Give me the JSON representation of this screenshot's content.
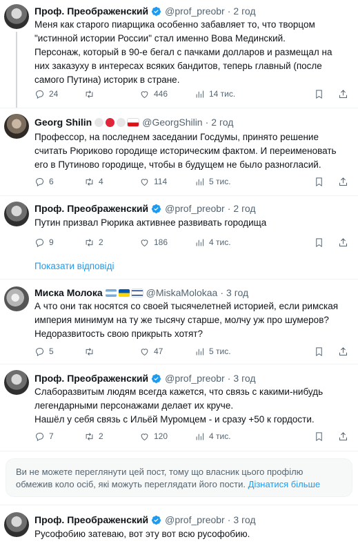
{
  "tweets": [
    {
      "name": "Проф. Преображенский",
      "handle": "@prof_preobr",
      "time": "2 год",
      "text": "Меня как старого пиарщика особенно забавляет то, что творцом \"истинной истории России\" стал именно Вова Мединский.\nПерсонаж, который в 90-е бегал с пачками долларов и размещал на них заказуху в интересах всяких бандитов, теперь главный (после самого Путина) историк в стране.",
      "replies": "24",
      "retweets": "",
      "likes": "446",
      "views": "14 тис."
    },
    {
      "name": "Georg Shilin",
      "handle": "@GeorgShilin",
      "time": "2 год",
      "text": "Профессор, на последнем заседании Госдумы, принято решение считать Рюриково городище историческим фактом. И переименовать его в Путиново городище, чтобы в будущем не было разногласий.",
      "replies": "6",
      "retweets": "4",
      "likes": "114",
      "views": "5 тис."
    },
    {
      "name": "Проф. Преображенский",
      "handle": "@prof_preobr",
      "time": "2 год",
      "text": "Путин призвал Рюрика активнее развивать городища",
      "replies": "9",
      "retweets": "2",
      "likes": "186",
      "views": "4 тис."
    },
    {
      "name": "Миска Молока",
      "handle": "@MiskaMolokaa",
      "time": "3 год",
      "text": "А что они так носятся со своей тысячелетней историей, если римская империя минимум на ту же тысячу старше, молчу уж про шумеров? Недоразвитость свою прикрыть хотят?",
      "replies": "5",
      "retweets": "",
      "likes": "47",
      "views": "5 тис."
    },
    {
      "name": "Проф. Преображенский",
      "handle": "@prof_preobr",
      "time": "3 год",
      "text": "Слаборазвитым людям всегда кажется, что связь с какими-нибудь легендарными персонажами делает их круче.\nНашёл у себя связь с Ильёй Муромцем - и сразу +50 к гордости.",
      "replies": "7",
      "retweets": "2",
      "likes": "120",
      "views": "4 тис."
    },
    {
      "name": "Проф. Преображенский",
      "handle": "@prof_preobr",
      "time": "3 год",
      "text": "Русофобию затеваю, вот эту вот всю русофобию."
    }
  ],
  "dot": "·",
  "show_replies": "Показати відповіді",
  "notice": {
    "text": "Ви не можете переглянути цей пост, тому що власник цього профілю обмежив коло осіб, які можуть переглядати його пости.",
    "link": "Дізнатися більше"
  },
  "colors": {
    "accent": "#1d9bf0",
    "muted": "#536471",
    "text": "#0f1419"
  },
  "icons": [
    "reply-icon",
    "retweet-icon",
    "like-icon",
    "views-icon",
    "bookmark-icon",
    "share-icon",
    "verified-icon"
  ]
}
